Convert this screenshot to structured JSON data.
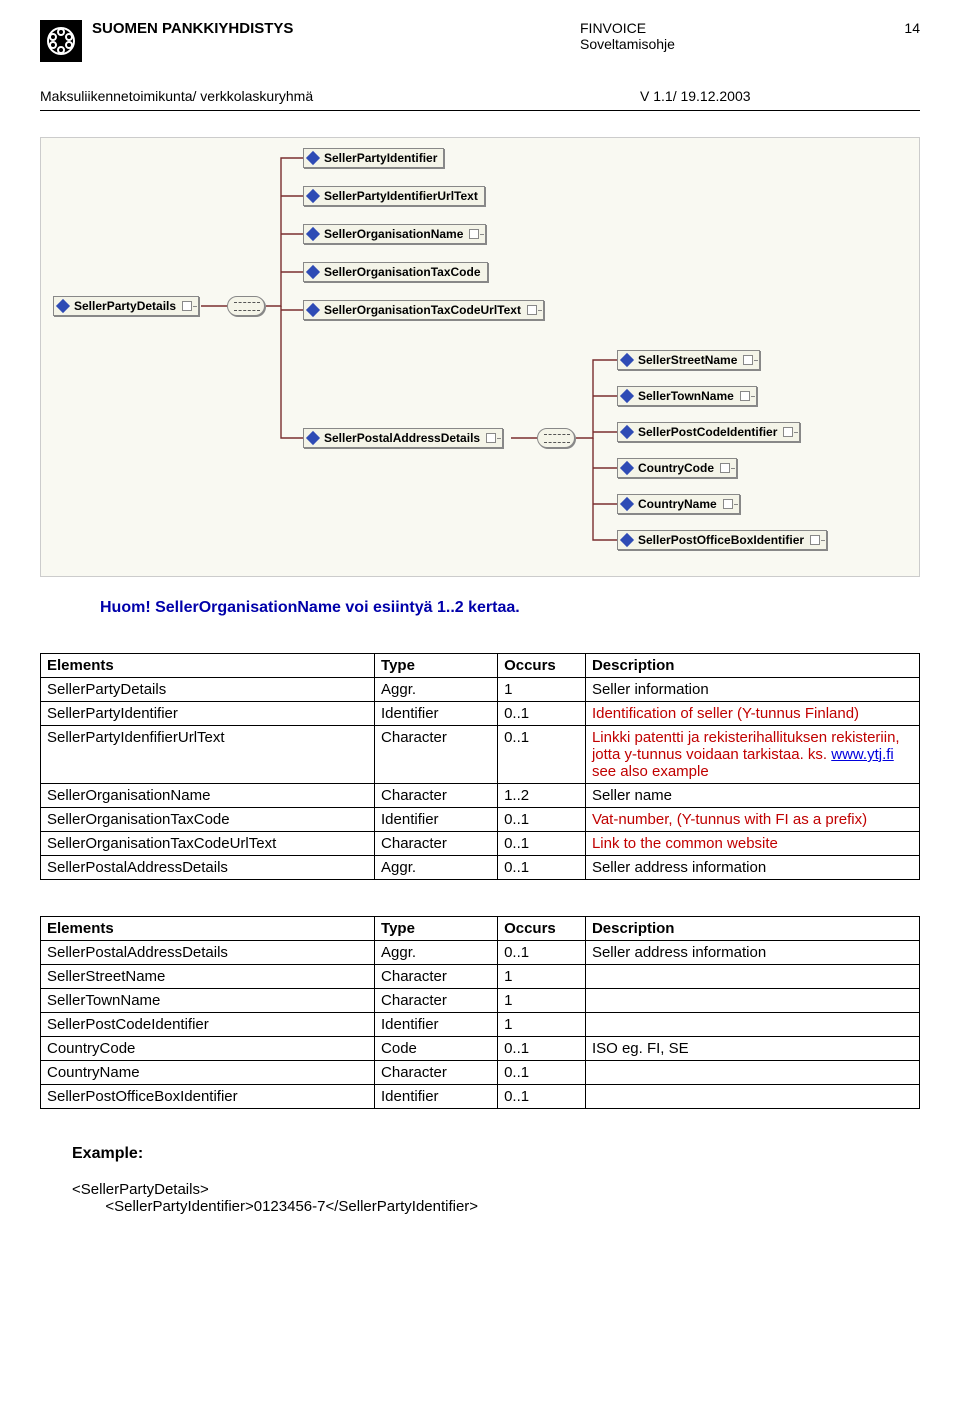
{
  "header": {
    "org_name": "SUOMEN PANKKIYHDISTYS",
    "doc_title": "FINVOICE",
    "doc_subtitle": "Soveltamisohje",
    "page_num": "14",
    "committee": "Maksuliikennetoimikunta/ verkkolaskuryhmä",
    "version": "V 1.1/ 19.12.2003"
  },
  "diagram": {
    "root": "SellerPartyDetails",
    "children": [
      "SellerPartyIdentifier",
      "SellerPartyIdentifierUrlText",
      "SellerOrganisationName",
      "SellerOrganisationTaxCode",
      "SellerOrganisationTaxCodeUrlText",
      "SellerPostalAddressDetails"
    ],
    "postal_children": [
      "SellerStreetName",
      "SellerTownName",
      "SellerPostCodeIdentifier",
      "CountryCode",
      "CountryName",
      "SellerPostOfficeBoxIdentifier"
    ]
  },
  "note": "Huom! SellerOrganisationName voi esiintyä 1..2 kertaa.",
  "table1": {
    "headers": [
      "Elements",
      "Type",
      "Occurs",
      "Description"
    ],
    "rows": [
      {
        "el": "SellerPartyDetails",
        "ty": "Aggr.",
        "oc": "1",
        "desc": "Seller information",
        "cls": "desc-black"
      },
      {
        "el": "SellerPartyIdentifier",
        "ty": "Identifier",
        "oc": "0..1",
        "desc": "Identification of seller (Y-tunnus Finland)",
        "cls": "desc-red"
      },
      {
        "el": "SellerPartyIdenfifierUrlText",
        "ty": "Character",
        "oc": "0..1",
        "desc": "Linkki patentti ja rekisterihallituksen rekisteriin, jotta y-tunnus voidaan tarkistaa. ks. ",
        "link": "www.ytj.fi",
        "tail": " see also example",
        "cls": "desc-red"
      },
      {
        "el": "SellerOrganisationName",
        "ty": "Character",
        "oc": "1..2",
        "desc": "Seller name",
        "cls": "desc-black"
      },
      {
        "el": "SellerOrganisationTaxCode",
        "ty": "Identifier",
        "oc": "0..1",
        "desc": "Vat-number, (Y-tunnus with FI as a prefix)",
        "cls": "desc-red"
      },
      {
        "el": "SellerOrganisationTaxCodeUrlText",
        "ty": "Character",
        "oc": "0..1",
        "desc": "Link to the common website",
        "cls": "desc-red"
      },
      {
        "el": "SellerPostalAddressDetails",
        "ty": "Aggr.",
        "oc": "0..1",
        "desc": "Seller address information",
        "cls": "desc-black"
      }
    ]
  },
  "table2": {
    "headers": [
      "Elements",
      "Type",
      "Occurs",
      "Description"
    ],
    "rows": [
      {
        "el": "SellerPostalAddressDetails",
        "ty": "Aggr.",
        "oc": "0..1",
        "desc": "Seller address information"
      },
      {
        "el": "SellerStreetName",
        "ty": "Character",
        "oc": "1",
        "desc": ""
      },
      {
        "el": "SellerTownName",
        "ty": "Character",
        "oc": "1",
        "desc": ""
      },
      {
        "el": "SellerPostCodeIdentifier",
        "ty": "Identifier",
        "oc": "1",
        "desc": ""
      },
      {
        "el": "CountryCode",
        "ty": "Code",
        "oc": "0..1",
        "desc": "ISO eg. FI, SE"
      },
      {
        "el": "CountryName",
        "ty": "Character",
        "oc": "0..1",
        "desc": ""
      },
      {
        "el": "SellerPostOfficeBoxIdentifier",
        "ty": "Identifier",
        "oc": "0..1",
        "desc": ""
      }
    ]
  },
  "example": {
    "heading": "Example:",
    "line1": "<SellerPartyDetails>",
    "line2": "        <SellerPartyIdentifier>0123456-7</SellerPartyIdentifier>"
  }
}
